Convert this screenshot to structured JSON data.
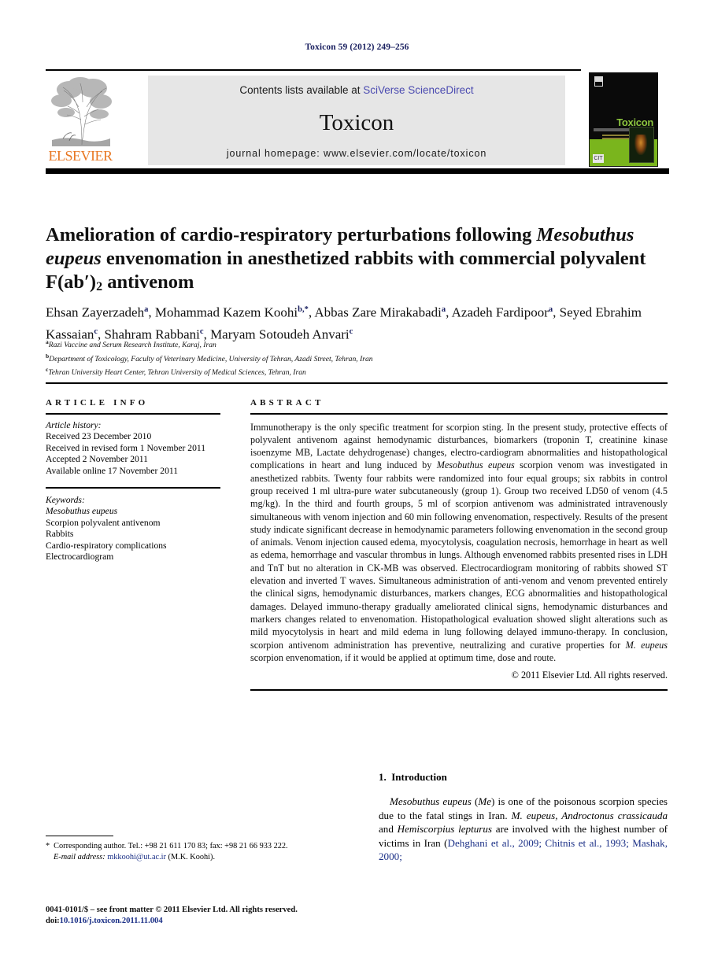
{
  "running_head": "Toxicon 59 (2012) 249–256",
  "masthead": {
    "contents_prefix": "Contents lists available at ",
    "sciencedirect": "SciVerse ScienceDirect",
    "journal_name": "Toxicon",
    "homepage": "journal homepage: www.elsevier.com/locate/toxicon",
    "publisher": "ELSEVIER",
    "cover_title": "Toxicon",
    "cover_badge": "CIT",
    "colors": {
      "elsevier_orange": "#E87722",
      "link_blue": "#4a4ab0",
      "running_head_navy": "#1a2060",
      "cover_green": "#7ab51d",
      "cover_title_green": "#8dc63f",
      "band_gray": "#e6e6e6"
    }
  },
  "article": {
    "title_part1": "Amelioration of cardio-respiratory perturbations following ",
    "title_italic1": "Mesobuthus eupeus",
    "title_part2": " envenomation in anesthetized rabbits with commercial polyvalent F(ab",
    "title_prime": "′",
    "title_part3": ")",
    "title_sub": "2",
    "title_part4": " antivenom",
    "authors": [
      {
        "name": "Ehsan Zayerzadeh",
        "marks": "a",
        "sep": ", "
      },
      {
        "name": "Mohammad Kazem Koohi",
        "marks": "b,*",
        "sep": ", "
      },
      {
        "name": "Abbas Zare Mirakabadi",
        "marks": "a",
        "sep": ", "
      },
      {
        "name": "Azadeh Fardipoor",
        "marks": "a",
        "sep": ", "
      },
      {
        "name": "Seyed Ebrahim Kassaian",
        "marks": "c",
        "sep": ", "
      },
      {
        "name": "Shahram Rabbani",
        "marks": "c",
        "sep": ", "
      },
      {
        "name": "Maryam Sotoudeh Anvari",
        "marks": "c",
        "sep": ""
      }
    ],
    "affiliations": [
      {
        "mark": "a",
        "text": "Razi Vaccine and Serum Research Institute, Karaj, Iran"
      },
      {
        "mark": "b",
        "text": "Department of Toxicology, Faculty of Veterinary Medicine, University of Tehran, Azadi Street, Tehran, Iran"
      },
      {
        "mark": "c",
        "text": "Tehran University Heart Center, Tehran University of Medical Sciences, Tehran, Iran"
      }
    ]
  },
  "article_info": {
    "heading": "ARTICLE INFO",
    "history_label": "Article history:",
    "history": [
      "Received 23 December 2010",
      "Received in revised form 1 November 2011",
      "Accepted 2 November 2011",
      "Available online 17 November 2011"
    ],
    "keywords_label": "Keywords:",
    "keywords": [
      "Mesobuthus eupeus",
      "Scorpion polyvalent antivenom",
      "Rabbits",
      "Cardio-respiratory complications",
      "Electrocardiogram"
    ],
    "keyword_italic_index": 0
  },
  "abstract": {
    "heading": "ABSTRACT",
    "p1": "Immunotherapy is the only specific treatment for scorpion sting. In the present study, protective effects of polyvalent antivenom against hemodynamic disturbances, biomarkers (troponin T, creatinine kinase isoenzyme MB, Lactate dehydrogenase) changes, electro-cardiogram abnormalities and histopathological complications in heart and lung induced by ",
    "p1_italic": "Mesobuthus eupeus",
    "p2": " scorpion venom was investigated in anesthetized rabbits. Twenty four rabbits were randomized into four equal groups; six rabbits in control group received 1 ml ultra-pure water subcutaneously (group 1). Group two received LD50 of venom (4.5 mg/kg). In the third and fourth groups, 5 ml of scorpion antivenom was administrated intravenously simultaneous with venom injection and 60 min following envenomation, respectively. Results of the present study indicate significant decrease in hemodynamic parameters following envenomation in the second group of animals. Venom injection caused edema, myocytolysis, coagulation necrosis, hemorrhage in heart as well as edema, hemorrhage and vascular thrombus in lungs. Although envenomed rabbits presented rises in LDH and TnT but no alteration in CK-MB was observed. Electrocardiogram monitoring of rabbits showed ST elevation and inverted T waves. Simultaneous administration of anti-venom and venom prevented entirely the clinical signs, hemodynamic disturbances, markers changes, ECG abnormalities and histopathological damages. Delayed immuno-therapy gradually ameliorated clinical signs, hemodynamic disturbances and markers changes related to envenomation. Histopathological evaluation showed slight alterations such as mild myocytolysis in heart and mild edema in lung following delayed immuno-therapy. In conclusion, scorpion antivenom administration has preventive, neutralizing and curative properties for ",
    "p2_italic": "M. eupeus",
    "p3": " scorpion envenomation, if it would be applied at optimum time, dose and route.",
    "copyright": "© 2011 Elsevier Ltd. All rights reserved."
  },
  "introduction": {
    "number": "1.",
    "heading": "Introduction",
    "text_a": "Mesobuthus eupeus",
    "text_b": " (",
    "text_c": "Me",
    "text_d": ") is one of the poisonous scorpion species due to the fatal stings in Iran. ",
    "text_e": "M. eupeus, Androctonus crassicauda",
    "text_f": " and ",
    "text_g": "Hemiscorpius lepturus",
    "text_h": " are involved with the highest number of victims in Iran (",
    "citation": "Dehghani et al., 2009; Chitnis et al., 1993; Mashak, 2000;"
  },
  "footnote": {
    "star": "*",
    "corresponding": "Corresponding author. Tel.: +98 21 611 170 83; fax: +98 21 66 933 222.",
    "email_label": "E-mail address:",
    "email": "mkkoohi@ut.ac.ir",
    "email_owner": "(M.K. Koohi)."
  },
  "imprint": {
    "line1": "0041-0101/$ – see front matter © 2011 Elsevier Ltd. All rights reserved.",
    "doi_label": "doi:",
    "doi_value": "10.1016/j.toxicon.2011.11.004"
  }
}
